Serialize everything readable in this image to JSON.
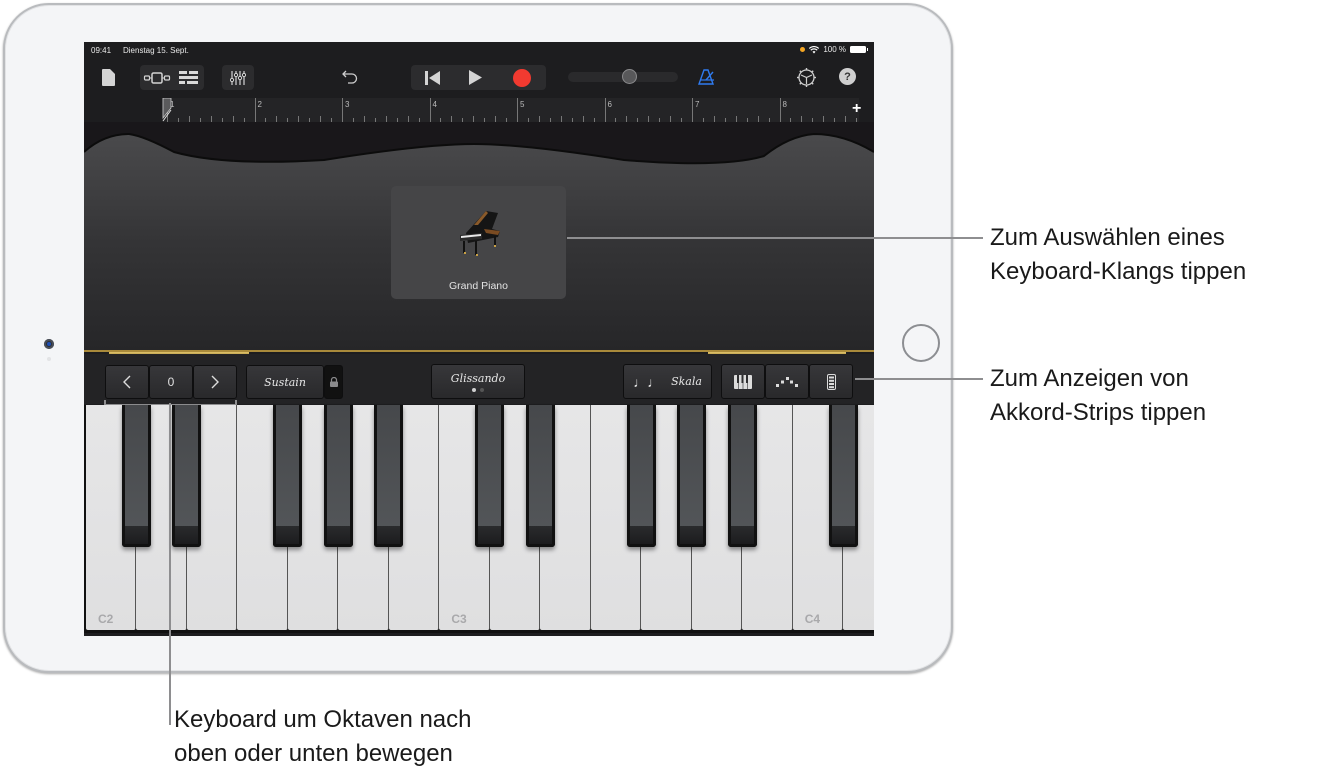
{
  "status_bar": {
    "time": "09:41",
    "date": "Dienstag 15. Sept.",
    "battery": "100 %",
    "recording_indicator_color": "#f5a623"
  },
  "toolbar": {
    "icons": [
      "document-icon",
      "view-toggle-icon",
      "tracks-view-icon",
      "mixer-icon",
      "undo-icon",
      "rewind-icon",
      "play-icon",
      "record-icon",
      "volume-slider",
      "metronome-icon",
      "settings-icon",
      "help-icon"
    ],
    "help_label": "?",
    "volume_level": 0.57,
    "record_color": "#f23a30",
    "metronome_color": "#2f7bf0"
  },
  "ruler": {
    "bars": [
      "1",
      "2",
      "3",
      "4",
      "5",
      "6",
      "7",
      "8"
    ],
    "add_label": "+"
  },
  "instrument": {
    "name": "Grand Piano"
  },
  "controls": {
    "octave_value": "0",
    "octave_down": "<",
    "octave_up": ">",
    "sustain_label": "Sustain",
    "glissando_label": "Glissando",
    "glissando_page": 1,
    "glissando_pages": 2,
    "scale_label": "Skala",
    "scale_icon": "♩♩",
    "layout_icons": [
      "keyboard-layout-icon",
      "arpeggiator-icon",
      "chord-strips-icon"
    ]
  },
  "keyboard": {
    "labels": [
      "C2",
      "C3",
      "C4"
    ],
    "white_key_count": 16
  },
  "callouts": {
    "sound_line1": "Zum Auswählen eines",
    "sound_line2": "Keyboard-Klangs tippen",
    "chords_line1": "Zum Anzeigen von",
    "chords_line2": "Akkord-Strips tippen",
    "octave_line1": "Keyboard um Oktaven nach",
    "octave_line2": "oben oder unten bewegen"
  },
  "colors": {
    "accent_gold": "#a98a3b",
    "screen_bg": "#1d1d1f"
  }
}
